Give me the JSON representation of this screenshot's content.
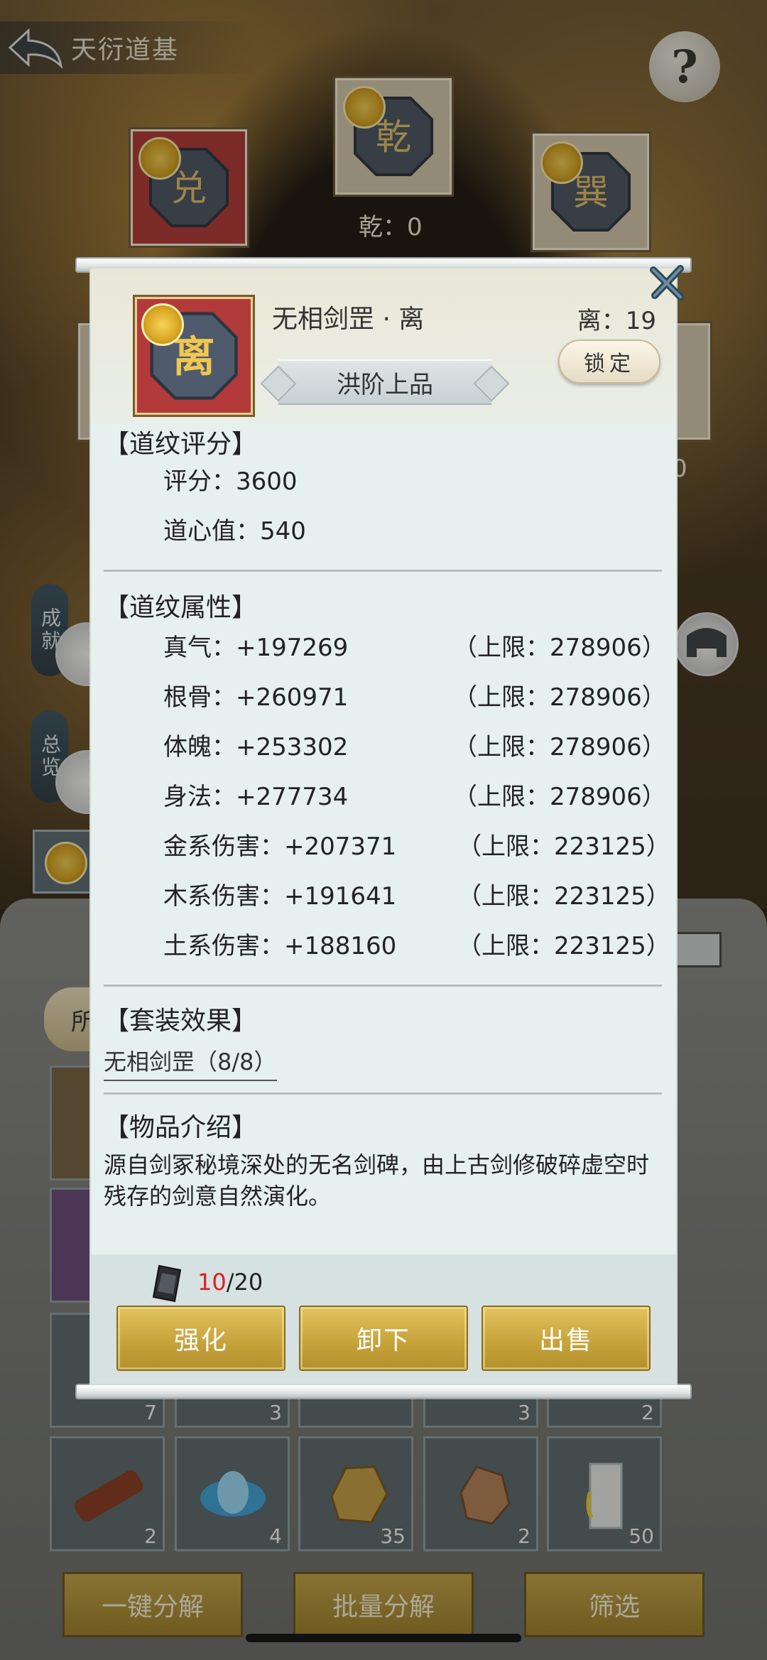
{
  "header": {
    "title": "天衍道基",
    "help_label": "?"
  },
  "board": {
    "qian_label": "乾：0",
    "partial_value": "0"
  },
  "side": {
    "achievement": "成就",
    "overview": "总览"
  },
  "inventory": {
    "filter_partial": "所",
    "counts": [
      "7",
      "3",
      "3",
      "2",
      "2",
      "4",
      "35",
      "2",
      "50"
    ]
  },
  "bottom_bar": {
    "decompose_one_key": "一键分解",
    "decompose_batch": "批量分解",
    "filter": "筛选"
  },
  "popup": {
    "item_name": "无相剑罡 · 离",
    "grade": "洪阶上品",
    "li_count": "离：19",
    "lock_label": "锁定",
    "score_section": {
      "title": "【道纹评分】",
      "score": "评分：3600",
      "daoxin": "道心值：540"
    },
    "attr_section": {
      "title": "【道纹属性】",
      "rows": [
        {
          "name": "真气：+197269",
          "cap": "（上限：278906）"
        },
        {
          "name": "根骨：+260971",
          "cap": "（上限：278906）"
        },
        {
          "name": "体魄：+253302",
          "cap": "（上限：278906）"
        },
        {
          "name": "身法：+277734",
          "cap": "（上限：278906）"
        },
        {
          "name": "金系伤害：+207371",
          "cap": "（上限：223125）"
        },
        {
          "name": "木系伤害：+191641",
          "cap": "（上限：223125）"
        },
        {
          "name": "土系伤害：+188160",
          "cap": "（上限：223125）"
        }
      ]
    },
    "set_section": {
      "title": "【套装效果】",
      "set_name": "无相剑罡（8/8）"
    },
    "intro_section": {
      "title": "【物品介绍】",
      "text": "源自剑冢秘境深处的无名剑碑，由上古剑修破碎虚空时残存的剑意自然演化。"
    },
    "footer": {
      "stone_current": "10",
      "stone_total": "/20",
      "enhance": "强化",
      "unequip": "卸下",
      "sell": "出售"
    }
  },
  "colors": {
    "popup_bg": "#e6f0ef",
    "gold_button": "#c8a43c",
    "stone_current": "#e01e1e",
    "slot_red": "#b33a3a"
  }
}
